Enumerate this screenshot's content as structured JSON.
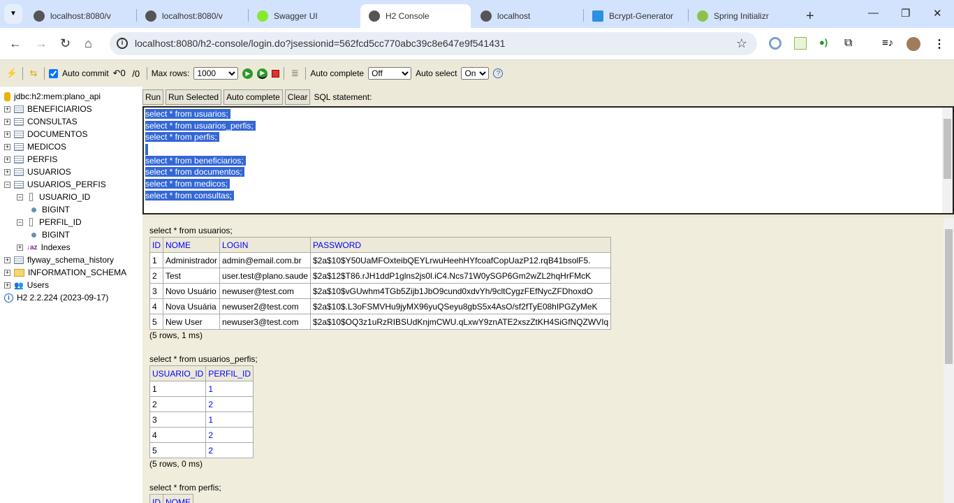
{
  "browser": {
    "tabs": [
      {
        "title": "localhost:8080/v",
        "icon": "globe-icon",
        "active": false
      },
      {
        "title": "localhost:8080/v",
        "icon": "globe-icon",
        "active": false
      },
      {
        "title": "Swagger UI",
        "icon": "swagger-icon",
        "active": false
      },
      {
        "title": "H2 Console",
        "icon": "globe-icon",
        "active": true
      },
      {
        "title": "localhost",
        "icon": "globe-icon",
        "active": false
      },
      {
        "title": "Bcrypt-Generator",
        "icon": "bcrypt-icon",
        "active": false
      },
      {
        "title": "Spring Initializr",
        "icon": "spring-icon",
        "active": false
      }
    ],
    "url": "localhost:8080/h2-console/login.do?jsessionid=562fcd5cc770abc39c8e647e9f541431"
  },
  "toolbar": {
    "auto_commit": "Auto commit",
    "auto_commit_checked": true,
    "max_rows_label": "Max rows:",
    "max_rows": "1000",
    "auto_complete_label": "Auto complete",
    "auto_complete": "Off",
    "auto_select_label": "Auto select",
    "auto_select": "On"
  },
  "tree": {
    "db": "jdbc:h2:mem:plano_api",
    "tables": [
      "BENEFICIARIOS",
      "CONSULTAS",
      "DOCUMENTOS",
      "MEDICOS",
      "PERFIS",
      "USUARIOS"
    ],
    "expanded": {
      "name": "USUARIOS_PERFIS",
      "columns": [
        {
          "name": "USUARIO_ID",
          "type": "BIGINT"
        },
        {
          "name": "PERFIL_ID",
          "type": "BIGINT"
        }
      ],
      "indexes": "Indexes"
    },
    "after": [
      "flyway_schema_history"
    ],
    "schema": "INFORMATION_SCHEMA",
    "users": "Users",
    "version": "H2 2.2.224 (2023-09-17)"
  },
  "sql": {
    "buttons": [
      "Run",
      "Run Selected",
      "Auto complete",
      "Clear"
    ],
    "label": "SQL statement:",
    "lines": [
      "select * from usuarios;",
      "select * from usuarios_perfis;",
      "select * from perfis;",
      "",
      "select * from beneficiarios;",
      "select * from documentos;",
      "select * from medicos;",
      "select * from consultas;"
    ]
  },
  "results": [
    {
      "query": "select * from usuarios;",
      "columns": [
        "ID",
        "NOME",
        "LOGIN",
        "PASSWORD"
      ],
      "rows": [
        [
          "1",
          "Administrador",
          "admin@email.com.br",
          "$2a$10$Y50UaMFOxteibQEYLrwuHeehHYfcoafCopUazP12.rqB41bsolF5."
        ],
        [
          "2",
          "Test",
          "user.test@plano.saude",
          "$2a$12$T86.rJH1ddP1glns2js0l.iC4.Ncs71W0ySGP6Gm2wZL2hqHrFMcK"
        ],
        [
          "3",
          "Novo Usuário",
          "newuser@test.com",
          "$2a$10$vGUwhm4TGb5Zijb1JbO9cund0xdvYh/9cltCygzFEfNycZFDhoxdO"
        ],
        [
          "4",
          "Nova Usuária",
          "newuser2@test.com",
          "$2a$10$.L3oFSMVHu9jyMX96yuQSeyu8gbS5x4AsO/sf2fTyE08hIPGZyMeK"
        ],
        [
          "5",
          "New User",
          "newuser3@test.com",
          "$2a$10$OQ3z1uRzRIBSUdKnjmCWU.qLxwY9znATE2xszZtKH4SiGfNQZWVIq"
        ]
      ],
      "status": "(5 rows, 1 ms)",
      "link_cols": []
    },
    {
      "query": "select * from usuarios_perfis;",
      "columns": [
        "USUARIO_ID",
        "PERFIL_ID"
      ],
      "rows": [
        [
          "1",
          "1"
        ],
        [
          "2",
          "2"
        ],
        [
          "3",
          "1"
        ],
        [
          "4",
          "2"
        ],
        [
          "5",
          "2"
        ]
      ],
      "status": "(5 rows, 0 ms)",
      "link_cols": [
        1
      ]
    },
    {
      "query": "select * from perfis;",
      "columns": [
        "ID",
        "NOME"
      ],
      "rows": [],
      "status": "",
      "link_cols": []
    }
  ]
}
